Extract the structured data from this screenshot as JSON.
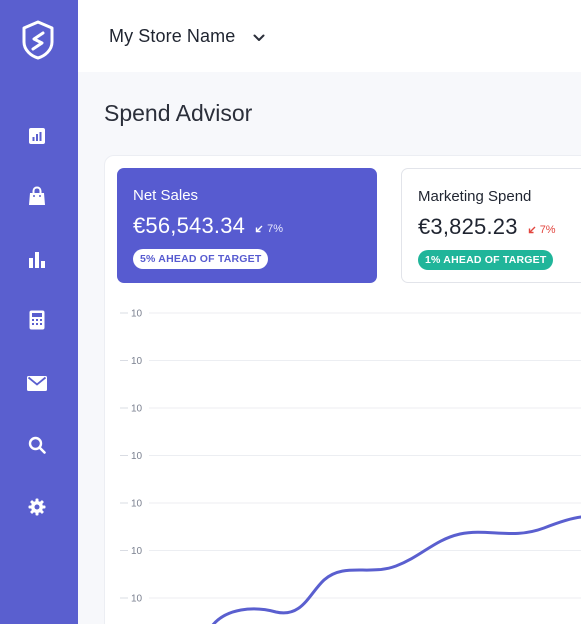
{
  "sidebar": {
    "items": [
      {
        "icon": "report-icon",
        "name": "sidebar-item-reports"
      },
      {
        "icon": "shopping-bag-icon",
        "name": "sidebar-item-shop"
      },
      {
        "icon": "bar-chart-icon",
        "name": "sidebar-item-analytics"
      },
      {
        "icon": "calculator-icon",
        "name": "sidebar-item-calculator"
      },
      {
        "icon": "mail-icon",
        "name": "sidebar-item-mail"
      },
      {
        "icon": "search-icon",
        "name": "sidebar-item-search"
      },
      {
        "icon": "gear-icon",
        "name": "sidebar-item-settings"
      }
    ],
    "color": "#5a5fcf"
  },
  "header": {
    "store_name": "My Store Name"
  },
  "page": {
    "title": "Spend Advisor"
  },
  "kpis": {
    "net_sales": {
      "label": "Net Sales",
      "value": "€56,543.34",
      "change": "7%",
      "badge": "5% AHEAD OF TARGET",
      "color": "#575bd0"
    },
    "marketing_spend": {
      "label": "Marketing Spend",
      "value": "€3,825.23",
      "change": "7%",
      "badge": "1% AHEAD OF TARGET",
      "change_color": "#e2463f",
      "badge_color": "#20b59a"
    }
  },
  "chart_data": {
    "type": "line",
    "y_tick_labels": [
      "10",
      "10",
      "10",
      "10",
      "10",
      "10",
      "10"
    ],
    "grid": true,
    "series_color": "#5a5fcf"
  }
}
